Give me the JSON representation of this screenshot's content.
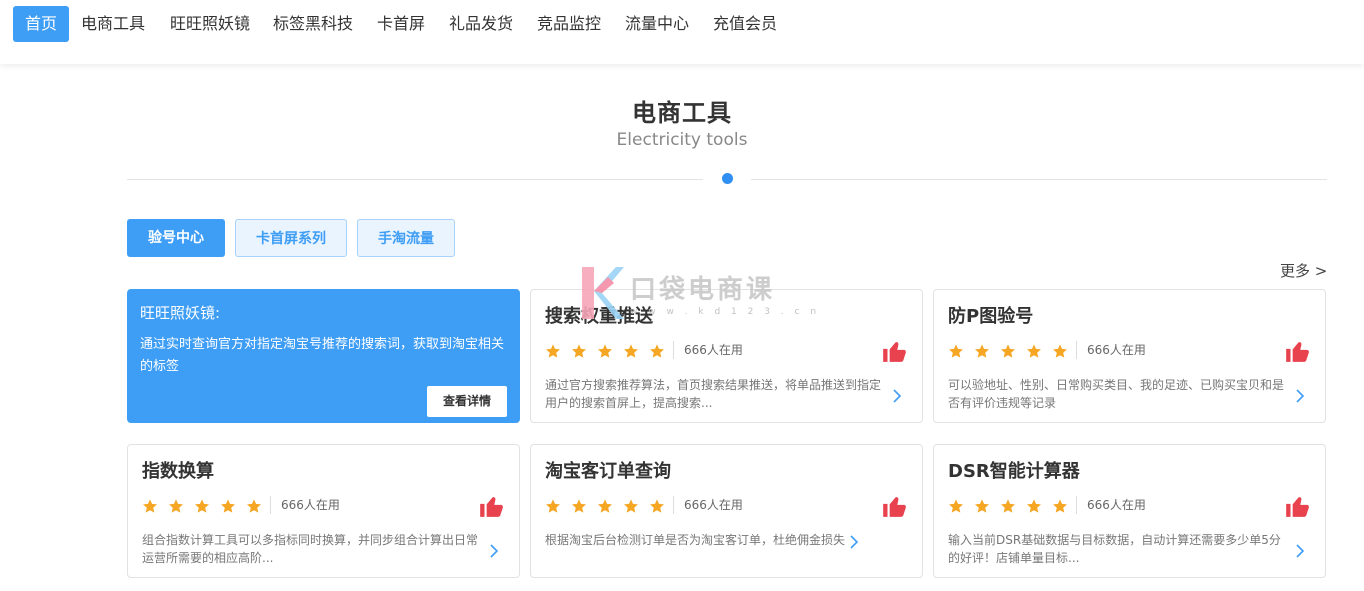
{
  "nav": {
    "items": [
      {
        "label": "首页",
        "active": true
      },
      {
        "label": "电商工具",
        "active": false
      },
      {
        "label": "旺旺照妖镜",
        "active": false
      },
      {
        "label": "标签黑科技",
        "active": false
      },
      {
        "label": "卡首屏",
        "active": false
      },
      {
        "label": "礼品发货",
        "active": false
      },
      {
        "label": "竞品监控",
        "active": false
      },
      {
        "label": "流量中心",
        "active": false
      },
      {
        "label": "充值会员",
        "active": false
      }
    ]
  },
  "section": {
    "title": "电商工具",
    "subtitle": "Electricity tools"
  },
  "tabs": [
    {
      "label": "验号中心",
      "active": true
    },
    {
      "label": "卡首屏系列",
      "active": false
    },
    {
      "label": "手淘流量",
      "active": false
    }
  ],
  "more_label": "更多 >",
  "featured": {
    "title": "旺旺照妖镜:",
    "desc": "通过实时查询官方对指定淘宝号推荐的搜索词，获取到淘宝相关的标签",
    "button": "查看详情"
  },
  "cards": [
    {
      "title": "搜索权重推送",
      "rating": 5,
      "users": "666人在用",
      "desc": "通过官方搜索推荐算法，首页搜索结果推送，将单品推送到指定用户的搜索首屏上，提高搜索..."
    },
    {
      "title": "防P图验号",
      "rating": 5,
      "users": "666人在用",
      "desc": "可以验地址、性别、日常购买类目、我的足迹、已购买宝贝和是否有评价违规等记录"
    },
    {
      "title": "指数换算",
      "rating": 5,
      "users": "666人在用",
      "desc": "组合指数计算工具可以多指标同时换算，并同步组合计算出日常运营所需要的相应高阶..."
    },
    {
      "title": "淘宝客订单查询",
      "rating": 5,
      "users": "666人在用",
      "desc": "根据淘宝后台检测订单是否为淘宝客订单，杜绝佣金损失"
    },
    {
      "title": "DSR智能计算器",
      "rating": 5,
      "users": "666人在用",
      "desc": "输入当前DSR基础数据与目标数据，自动计算还需要多少单5分的好评！店铺单量目标..."
    }
  ],
  "watermark": {
    "text": "口袋电商课",
    "url": "w w w . k d 1 2 3 . c n"
  },
  "colors": {
    "accent": "#3e9df5",
    "star": "#f5a623",
    "thumb": "#e8424f"
  },
  "icons": {
    "star": "star-icon",
    "thumb": "thumbs-up-icon",
    "chevron": "chevron-right-icon"
  }
}
